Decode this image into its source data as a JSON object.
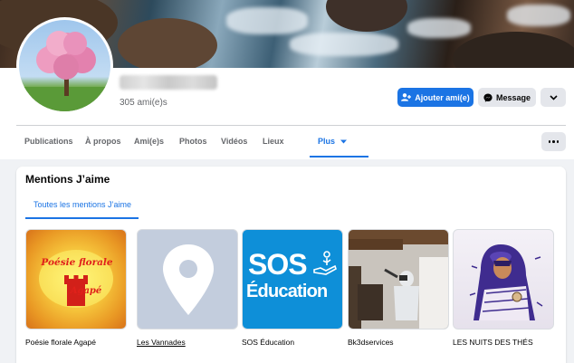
{
  "profile": {
    "friends_count": "305 ami(e)s"
  },
  "actions": {
    "add_friend": "Ajouter ami(e)",
    "message": "Message"
  },
  "tabs": [
    {
      "label": "Publications"
    },
    {
      "label": "À propos"
    },
    {
      "label": "Ami(e)s"
    },
    {
      "label": "Photos"
    },
    {
      "label": "Vidéos"
    },
    {
      "label": "Lieux"
    },
    {
      "label": "Plus",
      "active": true
    }
  ],
  "likes": {
    "title": "Mentions J’aime",
    "subtab": "Toutes les mentions J’aime",
    "pages": [
      {
        "name": "Poésie florale Agapé",
        "logo_line1": "Poésie florale",
        "logo_line2": "Agapé"
      },
      {
        "name": "Les Vannades"
      },
      {
        "name": "SOS Éducation",
        "logo_line1": "SOS",
        "logo_line2": "Éducation"
      },
      {
        "name": "Bk3dservices"
      },
      {
        "name": "LES NUITS DES THÉS"
      }
    ]
  },
  "colors": {
    "accent": "#1b74e4",
    "background": "#f0f2f5",
    "secondary_button": "#e4e6eb",
    "muted_text": "#65676b"
  },
  "icons": [
    "add-friend-icon",
    "messenger-icon",
    "chevron-down-icon",
    "caret-down-icon",
    "more-dots-icon",
    "map-pin-icon"
  ]
}
